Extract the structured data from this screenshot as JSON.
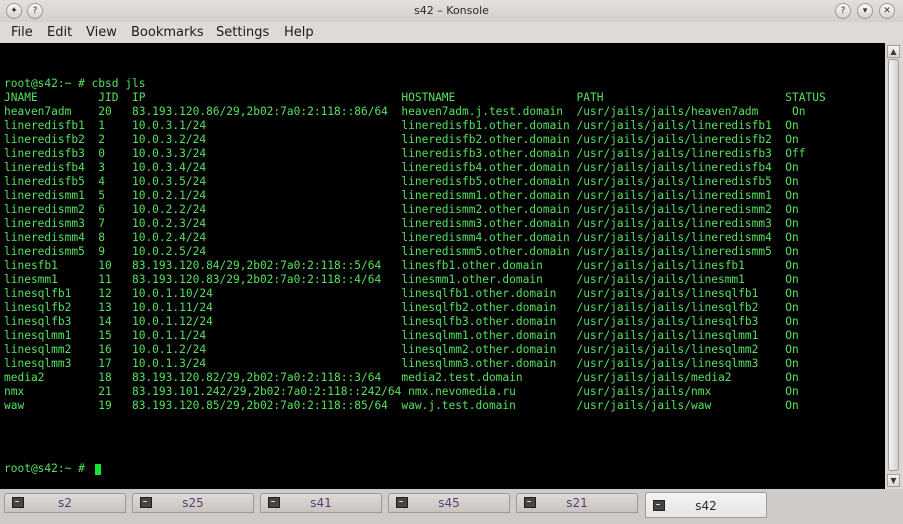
{
  "window": {
    "title": "s42 – Konsole"
  },
  "menu": [
    "File",
    "Edit",
    "View",
    "Bookmarks",
    "Settings",
    "Help"
  ],
  "terminal": {
    "lines": [
      "",
      "root@s42:~ # cbsd jls",
      "JNAME         JID  IP                                      HOSTNAME                  PATH                           STATUS",
      "heaven7adm    20   83.193.120.86/29,2b02:7a0:2:118::86/64  heaven7adm.j.test.domain  /usr/jails/jails/heaven7adm     On",
      "lineredisfb1  1    10.0.3.1/24                             lineredisfb1.other.domain /usr/jails/jails/lineredisfb1  On",
      "lineredisfb2  2    10.0.3.2/24                             lineredisfb2.other.domain /usr/jails/jails/lineredisfb2  On",
      "lineredisfb3  0    10.0.3.3/24                             lineredisfb3.other.domain /usr/jails/jails/lineredisfb3  Off",
      "lineredisfb4  3    10.0.3.4/24                             lineredisfb4.other.domain /usr/jails/jails/lineredisfb4  On",
      "lineredisfb5  4    10.0.3.5/24                             lineredisfb5.other.domain /usr/jails/jails/lineredisfb5  On",
      "lineredismm1  5    10.0.2.1/24                             lineredismm1.other.domain /usr/jails/jails/lineredismm1  On",
      "lineredismm2  6    10.0.2.2/24                             lineredismm2.other.domain /usr/jails/jails/lineredismm2  On",
      "lineredismm3  7    10.0.2.3/24                             lineredismm3.other.domain /usr/jails/jails/lineredismm3  On",
      "lineredismm4  8    10.0.2.4/24                             lineredismm4.other.domain /usr/jails/jails/lineredismm4  On",
      "lineredismm5  9    10.0.2.5/24                             lineredismm5.other.domain /usr/jails/jails/lineredismm5  On",
      "linesfb1      10   83.193.120.84/29,2b02:7a0:2:118::5/64   linesfb1.other.domain     /usr/jails/jails/linesfb1      On",
      "linesmm1      11   83.193.120.83/29,2b02:7a0:2:118::4/64   linesmm1.other.domain     /usr/jails/jails/linesmm1      On",
      "linesqlfb1    12   10.0.1.10/24                            linesqlfb1.other.domain   /usr/jails/jails/linesqlfb1    On",
      "linesqlfb2    13   10.0.1.11/24                            linesqlfb2.other.domain   /usr/jails/jails/linesqlfb2    On",
      "linesqlfb3    14   10.0.1.12/24                            linesqlfb3.other.domain   /usr/jails/jails/linesqlfb3    On",
      "linesqlmm1    15   10.0.1.1/24                             linesqlmm1.other.domain   /usr/jails/jails/linesqlmm1    On",
      "linesqlmm2    16   10.0.1.2/24                             linesqlmm2.other.domain   /usr/jails/jails/linesqlmm2    On",
      "linesqlmm3    17   10.0.1.3/24                             linesqlmm3.other.domain   /usr/jails/jails/linesqlmm3    On",
      "media2        18   83.193.120.82/29,2b02:7a0:2:118::3/64   media2.test.domain        /usr/jails/jails/media2        On",
      "nmx           21   83.193.101.242/29,2b02:7a0:2:118::242/64 nmx.nevomedia.ru         /usr/jails/jails/nmx           On",
      "waw           19   83.193.120.85/29,2b02:7a0:2:118::85/64  waw.j.test.domain         /usr/jails/jails/waw           On"
    ],
    "prompt": "root@s42:~ # "
  },
  "tabs": [
    {
      "label": "s2",
      "active": false
    },
    {
      "label": "s25",
      "active": false
    },
    {
      "label": "s41",
      "active": false
    },
    {
      "label": "s45",
      "active": false
    },
    {
      "label": "s21",
      "active": false
    },
    {
      "label": "s42",
      "active": true
    }
  ],
  "colors": {
    "terminal_bg": "#000000",
    "terminal_fg": "#55e05f",
    "cursor": "#18e633",
    "inactive_tab_label": "#5b3a6f"
  },
  "icons": {
    "title_left": "konsole-menu-icon",
    "title_right": [
      "help-icon",
      "minimize-icon",
      "maximize-icon",
      "close-icon"
    ],
    "tab": "terminal-icon"
  }
}
